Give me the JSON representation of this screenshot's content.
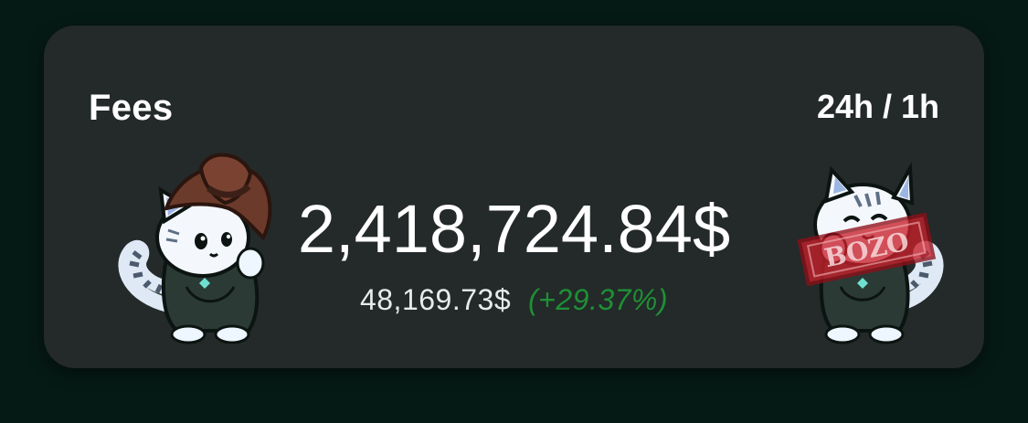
{
  "card": {
    "title": "Fees",
    "range_toggle": "24h / 1h",
    "total_value": "2,418,724.84$",
    "sub_value": "48,169.73$",
    "sub_change": "(+29.37%)"
  },
  "mascots": {
    "left_icon": "cowboy-cat-mascot-icon",
    "right_icon": "bozo-stamped-cat-mascot-icon",
    "right_stamp_text": "BOZO"
  },
  "colors": {
    "background": "#061a15",
    "card": "#232a29",
    "text": "#ffffff",
    "positive_change": "#1f8f35",
    "stamp_red": "#c8202b"
  }
}
